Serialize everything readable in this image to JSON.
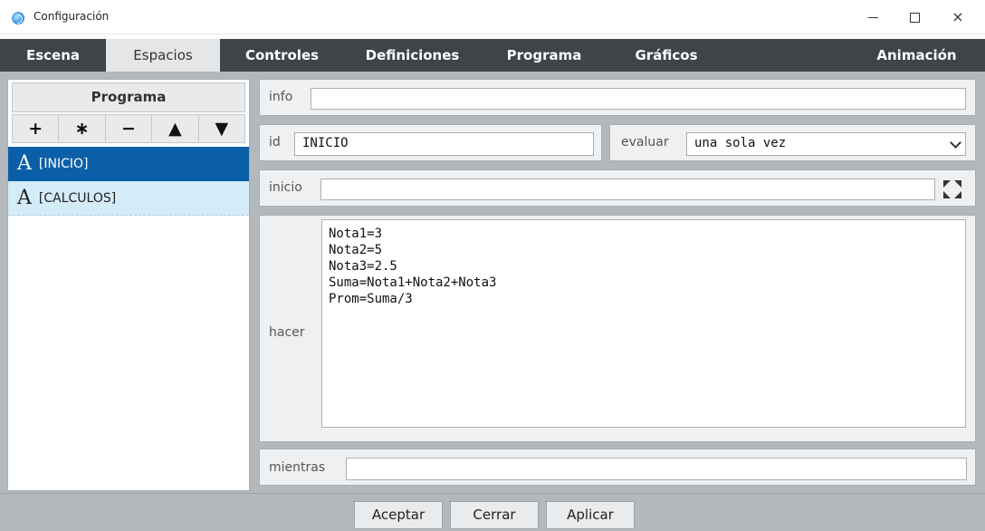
{
  "window": {
    "title": "Configuración",
    "close_glyph": "×"
  },
  "tabs": [
    {
      "label": "Escena",
      "active": false
    },
    {
      "label": "Espacios",
      "active": true
    },
    {
      "label": "Controles",
      "active": false
    },
    {
      "label": "Definiciones",
      "active": false
    },
    {
      "label": "Programa",
      "active": false
    },
    {
      "label": "Gráficos",
      "active": false
    },
    {
      "label": "Animación",
      "active": false
    }
  ],
  "left": {
    "header": "Programa",
    "tools": [
      "+",
      "∗",
      "−",
      "▲",
      "▼"
    ],
    "items": [
      {
        "icon": "A",
        "label": "[INICIO]",
        "selected": true
      },
      {
        "icon": "A",
        "label": "[CALCULOS]",
        "selected": false
      }
    ]
  },
  "form": {
    "info_label": "info",
    "info_value": "",
    "id_label": "id",
    "id_value": "INICIO",
    "evaluar_label": "evaluar",
    "evaluar_value": "una sola vez",
    "inicio_label": "inicio",
    "inicio_value": "",
    "hacer_label": "hacer",
    "hacer_value": "Nota1=3\nNota2=5\nNota3=2.5\nSuma=Nota1+Nota2+Nota3\nProm=Suma/3",
    "mientras_label": "mientras",
    "mientras_value": ""
  },
  "buttons": {
    "accept": "Aceptar",
    "close": "Cerrar",
    "apply": "Aplicar"
  },
  "colors": {
    "tabbar_bg": "#3f4448",
    "selected_item": "#0b5fa8",
    "alt_item": "#d3ecf8",
    "panel_bg": "#b3b8bc"
  }
}
